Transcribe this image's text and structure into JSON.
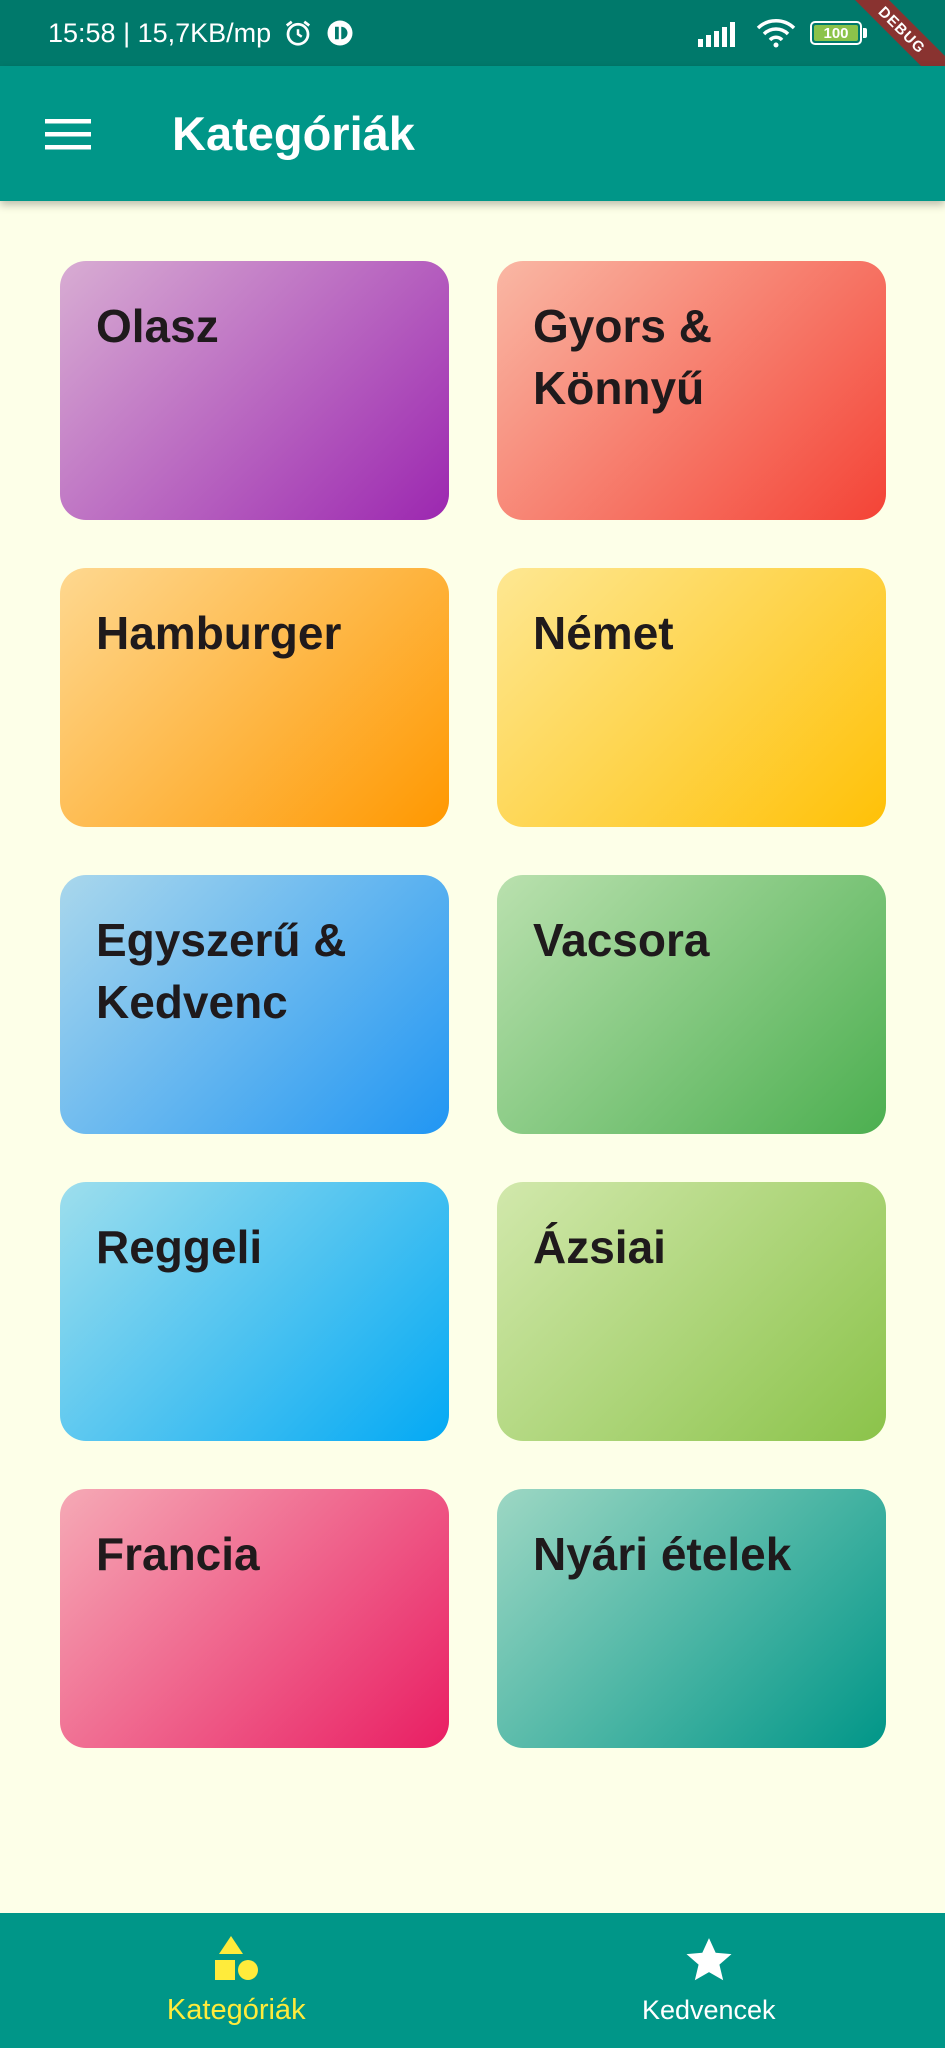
{
  "status_bar": {
    "time_speed": "15:58 | 15,7KB/mp",
    "battery": "100",
    "battery_level": 1.0,
    "debug_banner": "DEBUG",
    "icons": [
      "alarm-icon",
      "app-notification-icon",
      "signal-icon",
      "wifi-icon",
      "battery-icon"
    ]
  },
  "app_bar": {
    "title": "Kategóriák",
    "menu_icon": "menu-icon"
  },
  "categories": [
    {
      "title": "Olasz",
      "color": "#9c27b0"
    },
    {
      "title": "Gyors & Könnyű",
      "color": "#f44336"
    },
    {
      "title": "Hamburger",
      "color": "#ff9800"
    },
    {
      "title": "Német",
      "color": "#ffc107"
    },
    {
      "title": "Egyszerű & Kedvenc",
      "color": "#2196f3"
    },
    {
      "title": "Vacsora",
      "color": "#4caf50"
    },
    {
      "title": "Reggeli",
      "color": "#03a9f4"
    },
    {
      "title": "Ázsiai",
      "color": "#8bc34a"
    },
    {
      "title": "Francia",
      "color": "#e91e63"
    },
    {
      "title": "Nyári ételek",
      "color": "#009688"
    }
  ],
  "bottom_nav": {
    "items": [
      {
        "label": "Kategóriák",
        "icon": "category-icon",
        "active": true
      },
      {
        "label": "Kedvencek",
        "icon": "star-icon",
        "active": false
      }
    ],
    "active_color": "#ffeb3b"
  },
  "colors": {
    "primary": "#009688",
    "status_bar": "#00796b",
    "background": "#fdffe8"
  }
}
